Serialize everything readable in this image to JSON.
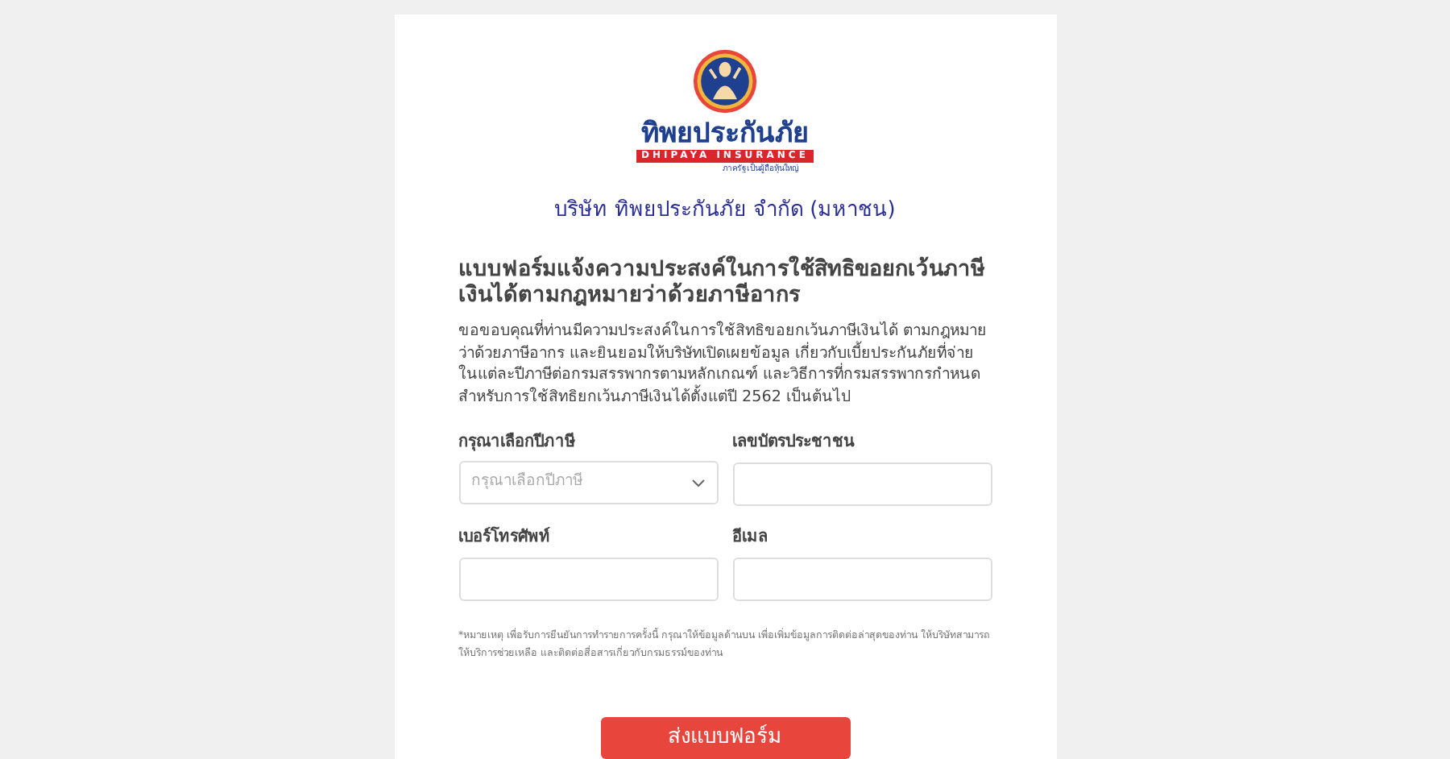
{
  "logo": {
    "wordmark": "ทิพยประกันภัย",
    "banner": "DHIPAYA INSURANCE",
    "tagline": "ภาครัฐเป็นผู้ถือหุ้นใหญ่"
  },
  "company_name": "บริษัท ทิพยประกันภัย จำกัด (มหาชน)",
  "form": {
    "title": "แบบฟอร์มแจ้งความประสงค์ในการใช้สิทธิขอยกเว้นภาษีเงินได้ตามกฎหมายว่าด้วยภาษีอากร",
    "intro": "ขอขอบคุณที่ท่านมีความประสงค์ในการใช้สิทธิขอยกเว้นภาษีเงินได้ ตามกฎหมายว่าด้วยภาษีอากร และยินยอมให้บริษัทเปิดเผยข้อมูล เกี่ยวกับเบี้ยประกันภัยที่จ่ายในแต่ละปีภาษีต่อกรมสรรพากรตามหลักเกณฑ์ และวิธีการที่กรมสรรพากรกำหนด สำหรับการใช้สิทธิยกเว้นภาษีเงินได้ตั้งแต่ปี 2562 เป็นต้นไป",
    "fields": [
      {
        "kind": "select",
        "label": "กรุณาเลือกปีภาษี",
        "placeholder": "กรุณาเลือกปีภาษี"
      },
      {
        "kind": "text",
        "label": "เลขบัตรประชาชน"
      },
      {
        "kind": "text",
        "label": "เบอร์โทรศัพท์"
      },
      {
        "kind": "text",
        "label": "อีเมล"
      }
    ],
    "note": "*หมายเหตุ เพื่อรับการยืนยันการทำรายการครั้งนี้ กรุณาให้ข้อมูลด้านบน เพื่อเพิ่มข้อมูลการติดต่อล่าสุดของท่าน ให้บริษัทสามารถให้บริการช่วยเหลือ และติดต่อสื่อสารเกี่ยวกับกรมธรรม์ของท่าน",
    "submit": "ส่งแบบฟอร์ม"
  }
}
